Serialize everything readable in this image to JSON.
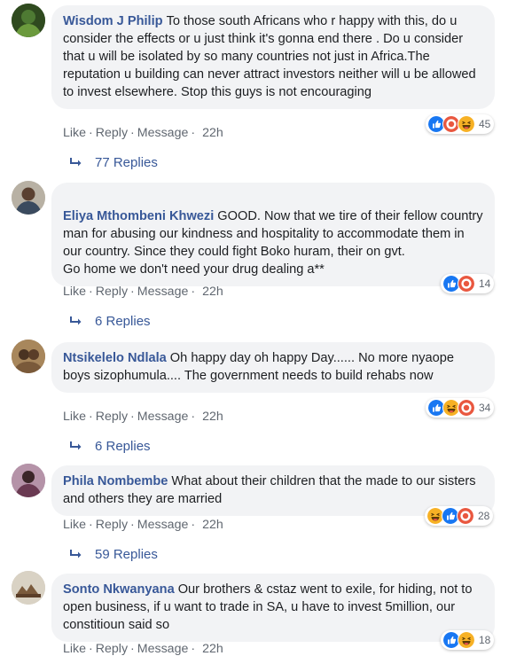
{
  "comments": [
    {
      "author": "Wisdom J Philip",
      "text": "To those south Africans who r happy with this, do u consider the effects or u just think it's gonna end there . Do u consider that u will be isolated by so many countries not just in Africa.The reputation u building can never attract investors neither will u be allowed to invest elsewhere. Stop this guys is not encouraging",
      "like": "Like",
      "reply": "Reply",
      "message": "Message",
      "time": "22h",
      "reactions": [
        "like",
        "angry",
        "haha"
      ],
      "reaction_count": "45",
      "replies": "77 Replies"
    },
    {
      "author": "Eliya Mthombeni Khwezi",
      "text": "GOOD. Now that we tire of their fellow country man for abusing our kindness and hospitality to accommodate them in our country. Since they could fight Boko huram, their on gvt.\nGo home we don't need your drug dealing a**",
      "like": "Like",
      "reply": "Reply",
      "message": "Message",
      "time": "22h",
      "reactions": [
        "like",
        "angry"
      ],
      "reaction_count": "14",
      "replies": "6 Replies"
    },
    {
      "author": "Ntsikelelo Ndlala",
      "text": "Oh happy day oh happy Day...... No more nyaope boys sizophumula.... The government needs to build rehabs now",
      "like": "Like",
      "reply": "Reply",
      "message": "Message",
      "time": "22h",
      "reactions": [
        "like",
        "haha",
        "angry"
      ],
      "reaction_count": "34",
      "replies": "6 Replies"
    },
    {
      "author": "Phila Nombembe",
      "text": "What about their children that the made to our sisters and others they are married",
      "like": "Like",
      "reply": "Reply",
      "message": "Message",
      "time": "22h",
      "reactions": [
        "haha",
        "like",
        "angry"
      ],
      "reaction_count": "28",
      "replies": "59 Replies"
    },
    {
      "author": "Sonto Nkwanyana",
      "text": "Our brothers & cstaz went to exile, for hiding, not to open business, if u want to trade in SA, u have to invest 5million, our constitioun said so",
      "like": "Like",
      "reply": "Reply",
      "message": "Message",
      "time": "22h",
      "reactions": [
        "like",
        "haha"
      ],
      "reaction_count": "18",
      "replies": ""
    }
  ],
  "colors": {
    "name": "#385898",
    "meta": "#606770",
    "bubble": "#f2f3f5",
    "like": "#1877f2",
    "angry": "#e9573f",
    "haha": "#f7b125"
  }
}
